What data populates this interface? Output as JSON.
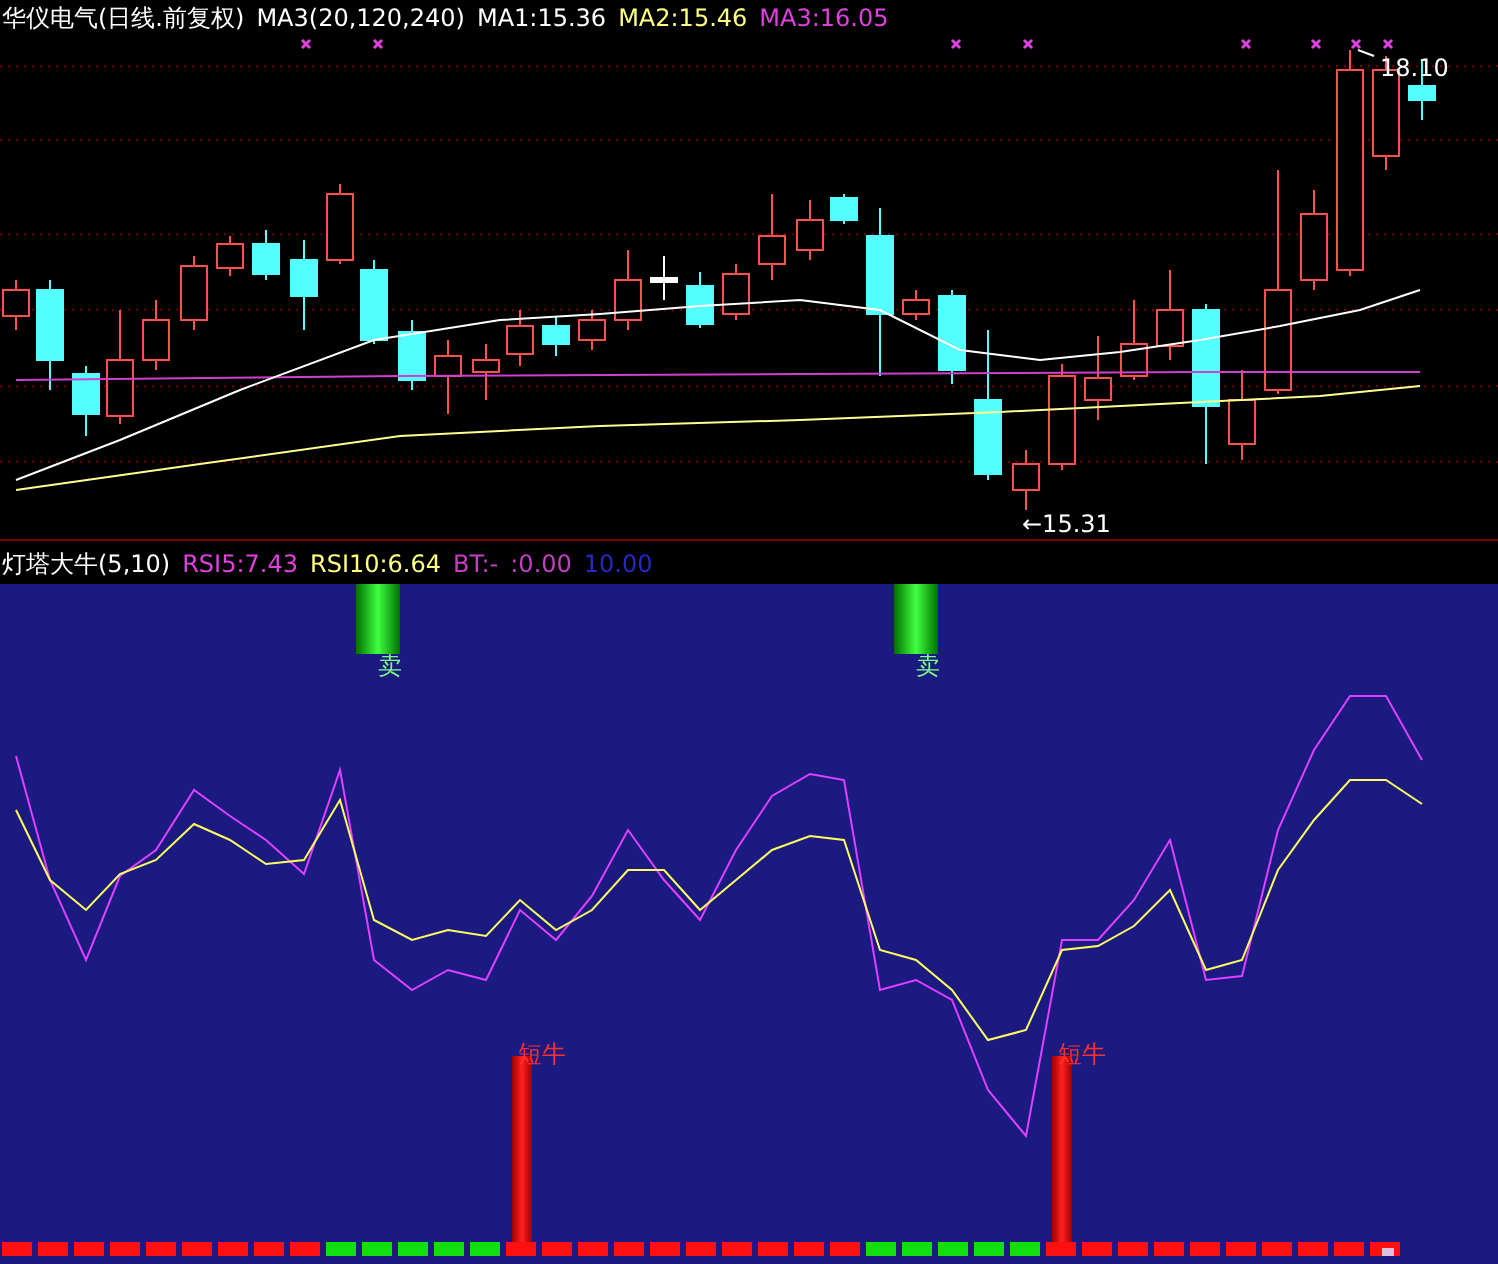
{
  "price_header": {
    "title": "华仪电气(日线.前复权)",
    "items": [
      {
        "text": "MA3(20,120,240)",
        "color": "#ffffff"
      },
      {
        "text": "MA1:15.36",
        "color": "#ffffff"
      },
      {
        "text": "MA2:15.46",
        "color": "#ffff80"
      },
      {
        "text": "MA3:16.05",
        "color": "#e040e0"
      }
    ]
  },
  "price_chart": {
    "high_label": "18.10",
    "low_label": "←15.31"
  },
  "indicator_header": {
    "title": "灯塔大牛(5,10)",
    "items": [
      {
        "text": "RSI5:7.43",
        "color": "#e040e0"
      },
      {
        "text": "RSI10:6.64",
        "color": "#ffff80"
      },
      {
        "text": "BT:-",
        "color": "#c040c0"
      },
      {
        "text": ":0.00",
        "color": "#c040c0"
      },
      {
        "text": "10.00",
        "color": "#2828c8"
      }
    ]
  },
  "indicator_chart": {
    "sell_labels": [
      "卖",
      "卖"
    ],
    "bull_labels": [
      "短牛",
      "短牛"
    ]
  }
}
